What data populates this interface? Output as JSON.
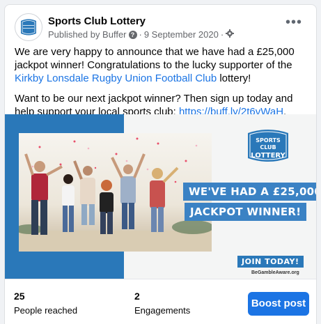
{
  "post": {
    "page_name": "Sports Club Lottery",
    "avatar_text": "SPORTS CLUB LOTTERY",
    "published_by": "Published by Buffer",
    "info_glyph": "?",
    "separator": "·",
    "date": "9 September 2020",
    "more_glyph": "•••",
    "body_line1": "We are very happy to announce that we have had a £25,000 jackpot winner! Congratulations to the lucky supporter of the ",
    "club_link": "Kirkby Lonsdale Rugby Union Football Club",
    "body_line1_end": " lottery!",
    "body_line2": "Want to be our next jackpot winner? Then sign up today and help support your local sports club: ",
    "buff_link": "https://buff.ly/2t6vWaH",
    "body_line2_end": "."
  },
  "media": {
    "logo_line1": "SPORTS CLUB",
    "logo_line2": "LOTTERY",
    "banner1": "WE'VE HAD A £25,000",
    "banner2": "JACKPOT WINNER!",
    "join": "JOIN TODAY!",
    "gamble": "BeGambleAware.org"
  },
  "stats": {
    "reached_value": "25",
    "reached_label": "People reached",
    "engagements_value": "2",
    "engagements_label": "Engagements",
    "boost_label": "Boost post"
  },
  "colors": {
    "accent": "#1b74e4",
    "brand_blue": "#2a78b9"
  }
}
